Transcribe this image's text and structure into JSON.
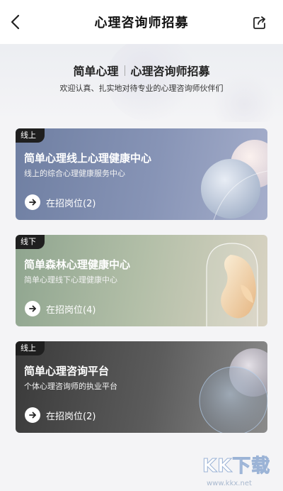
{
  "header": {
    "title": "心理咨询师招募",
    "back_icon": "chevron-left-icon",
    "share_icon": "share-icon"
  },
  "hero": {
    "brand": "简单心理",
    "title": "心理咨询师招募",
    "subtitle": "欢迎认真、扎实地对待专业的心理咨询师伙伴们"
  },
  "cards": [
    {
      "badge": "线上",
      "title": "简单心理线上心理健康中心",
      "subtitle": "线上的综合心理健康服务中心",
      "link": "在招岗位(2)",
      "color_start": "#6f7fa2",
      "color_end": "#a5aecb"
    },
    {
      "badge": "线下",
      "title": "简单森林心理健康中心",
      "subtitle": "简单心理线下心理健康中心",
      "link": "在招岗位(4)",
      "color_start": "#8fa58f",
      "color_end": "#d9d3c3"
    },
    {
      "badge": "线上",
      "title": "简单心理咨询平台",
      "subtitle": "个体心理咨询师的执业平台",
      "link": "在招岗位(2)",
      "color_start": "#3a3a3a",
      "color_end": "#8b8b8b"
    }
  ],
  "watermark": {
    "text": "KK下载",
    "url": "www.kkx.net"
  }
}
